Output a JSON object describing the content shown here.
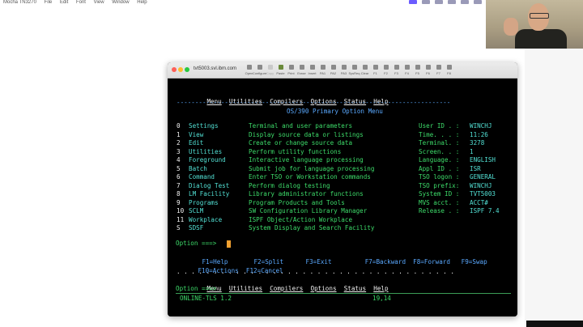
{
  "menubar": {
    "app": "Mocha TN3270",
    "items": [
      "File",
      "Edit",
      "Font",
      "View",
      "Window",
      "Help"
    ]
  },
  "window": {
    "title": "tvt5003.svl.ibm.com",
    "toolbar": [
      "Open",
      "Configure",
      "Copy",
      "Paste",
      "Print",
      "Erase",
      "Insert",
      "PA1",
      "PA2",
      "PA3",
      "SysReq",
      "Clear",
      "F1",
      "F2",
      "F3",
      "F4",
      "F5",
      "F6",
      "F7",
      "F8"
    ]
  },
  "terminal": {
    "action_bar": [
      "Menu",
      "Utilities",
      "Compilers",
      "Options",
      "Status",
      "Help"
    ],
    "divider": "--------------------------------------------------------------------------",
    "panel_title": "OS/390 Primary Option Menu",
    "options": [
      {
        "key": "0",
        "name": "Settings",
        "desc": "Terminal and user parameters"
      },
      {
        "key": "1",
        "name": "View",
        "desc": "Display source data or listings"
      },
      {
        "key": "2",
        "name": "Edit",
        "desc": "Create or change source data"
      },
      {
        "key": "3",
        "name": "Utilities",
        "desc": "Perform utility functions"
      },
      {
        "key": "4",
        "name": "Foreground",
        "desc": "Interactive language processing"
      },
      {
        "key": "5",
        "name": "Batch",
        "desc": "Submit job for language processing"
      },
      {
        "key": "6",
        "name": "Command",
        "desc": "Enter TSO or Workstation commands"
      },
      {
        "key": "7",
        "name": "Dialog Test",
        "desc": "Perform dialog testing"
      },
      {
        "key": "8",
        "name": "LM Facility",
        "desc": "Library administrator functions"
      },
      {
        "key": "9",
        "name": "Programs",
        "desc": "Program Products and Tools"
      },
      {
        "key": "10",
        "name": "SCLM",
        "desc": "SW Configuration Library Manager"
      },
      {
        "key": "11",
        "name": "Workplace",
        "desc": "ISPF Object/Action Workplace"
      },
      {
        "key": "S",
        "name": "SDSF",
        "desc": "System Display and Search Facility"
      }
    ],
    "info": [
      {
        "label": "User ID . :",
        "value": "WINCHJ"
      },
      {
        "label": "Time. . . :",
        "value": "11:26"
      },
      {
        "label": "Terminal. :",
        "value": "3278"
      },
      {
        "label": "Screen. . :",
        "value": "1"
      },
      {
        "label": "Language. :",
        "value": "ENGLISH"
      },
      {
        "label": "Appl ID . :",
        "value": "ISR"
      },
      {
        "label": "TSO logon :",
        "value": "GENERAL"
      },
      {
        "label": "TSO prefix:",
        "value": "WINCHJ"
      },
      {
        "label": "System ID :",
        "value": "TVT5003"
      },
      {
        "label": "MVS acct. :",
        "value": "ACCT#"
      },
      {
        "label": "Release . :",
        "value": "ISPF 7.4"
      }
    ],
    "option_prompt": "Option ===>",
    "pf_keys_row1": [
      {
        "key": "F1",
        "label": "Help"
      },
      {
        "key": "F2",
        "label": "Split"
      },
      {
        "key": "F3",
        "label": "Exit"
      },
      {
        "key": "F7",
        "label": "Backward"
      },
      {
        "key": "F8",
        "label": "Forward"
      },
      {
        "key": "F9",
        "label": "Swap"
      }
    ],
    "pf_keys_row2": [
      {
        "key": "F10",
        "label": "Actions"
      },
      {
        "key": "F12",
        "label": "Cancel"
      }
    ],
    "dotted_line": ". . . . . . . . . . . . . . . . . . . . . . . . . . . . . . . . . . . . . .",
    "bottom_action_bar": [
      "Menu",
      "Utilities",
      "Compilers",
      "Options",
      "Status",
      "Help"
    ],
    "bottom_prompt": "Option ===>",
    "status_left": "ONLINE-TLS 1.2",
    "status_pos": "19,14"
  },
  "colors": {
    "background": "#000000",
    "green": "#3ddc6a",
    "cyan": "#7fd7ff",
    "blue": "#5aa9ff",
    "white": "#f2f2f2",
    "cursor": "#f0a030"
  }
}
